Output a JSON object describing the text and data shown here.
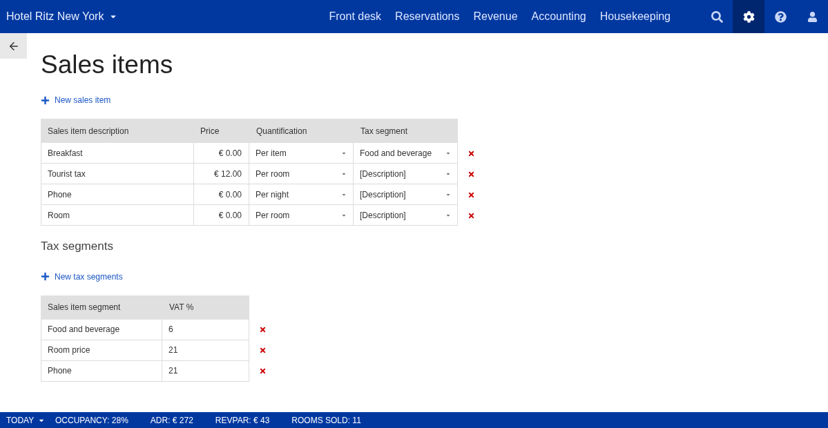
{
  "app_bar": {
    "hotel": "Hotel Ritz New York",
    "nav": [
      {
        "label": "Front desk"
      },
      {
        "label": "Reservations"
      },
      {
        "label": "Revenue"
      },
      {
        "label": "Accounting"
      },
      {
        "label": "Housekeeping"
      }
    ],
    "icons": [
      {
        "kind": "search",
        "selected": false
      },
      {
        "kind": "settings",
        "selected": true
      },
      {
        "kind": "help",
        "selected": false
      },
      {
        "kind": "user",
        "selected": false
      }
    ]
  },
  "page": {
    "title": "Sales items",
    "new_item": "New sales item"
  },
  "sales_table": {
    "columns": [
      "Sales item description",
      "Price",
      "Quantification",
      "Tax segment"
    ],
    "rows": [
      {
        "description": "Breakfast",
        "price": "€ 0.00",
        "quantification": "Per item",
        "tax_segment": "Food and beverage"
      },
      {
        "description": "Tourist tax",
        "price": "€ 12.00",
        "quantification": "Per room",
        "tax_segment": "[Description]"
      },
      {
        "description": "Phone",
        "price": "€ 0.00",
        "quantification": "Per night",
        "tax_segment": "[Description]"
      },
      {
        "description": "Room",
        "price": "€ 0.00",
        "quantification": "Per room",
        "tax_segment": "[Description]"
      }
    ]
  },
  "tax_section": {
    "title": "Tax segments",
    "new_item": "New tax segments",
    "columns": [
      "Sales item segment",
      "VAT %"
    ],
    "rows": [
      {
        "segment": "Food and beverage",
        "vat": "6"
      },
      {
        "segment": "Room price",
        "vat": "21"
      },
      {
        "segment": "Phone",
        "vat": "21"
      }
    ]
  },
  "status_bar": {
    "period": "TODAY",
    "stats": [
      "OCCUPANCY: 28%",
      "ADR: € 272",
      "REVPAR: € 43",
      "ROOMS SOLD: 11"
    ]
  }
}
